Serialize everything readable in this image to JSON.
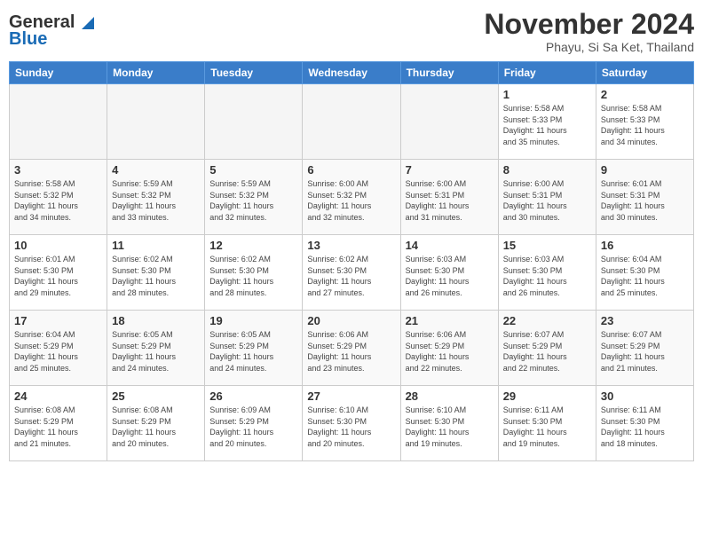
{
  "header": {
    "logo": {
      "line1": "General",
      "line2": "Blue"
    },
    "month": "November 2024",
    "location": "Phayu, Si Sa Ket, Thailand"
  },
  "weekdays": [
    "Sunday",
    "Monday",
    "Tuesday",
    "Wednesday",
    "Thursday",
    "Friday",
    "Saturday"
  ],
  "weeks": [
    {
      "rowClass": "row-odd",
      "days": [
        {
          "num": "",
          "info": "",
          "empty": true
        },
        {
          "num": "",
          "info": "",
          "empty": true
        },
        {
          "num": "",
          "info": "",
          "empty": true
        },
        {
          "num": "",
          "info": "",
          "empty": true
        },
        {
          "num": "",
          "info": "",
          "empty": true
        },
        {
          "num": "1",
          "info": "Sunrise: 5:58 AM\nSunset: 5:33 PM\nDaylight: 11 hours\nand 35 minutes."
        },
        {
          "num": "2",
          "info": "Sunrise: 5:58 AM\nSunset: 5:33 PM\nDaylight: 11 hours\nand 34 minutes."
        }
      ]
    },
    {
      "rowClass": "row-even",
      "days": [
        {
          "num": "3",
          "info": "Sunrise: 5:58 AM\nSunset: 5:32 PM\nDaylight: 11 hours\nand 34 minutes."
        },
        {
          "num": "4",
          "info": "Sunrise: 5:59 AM\nSunset: 5:32 PM\nDaylight: 11 hours\nand 33 minutes."
        },
        {
          "num": "5",
          "info": "Sunrise: 5:59 AM\nSunset: 5:32 PM\nDaylight: 11 hours\nand 32 minutes."
        },
        {
          "num": "6",
          "info": "Sunrise: 6:00 AM\nSunset: 5:32 PM\nDaylight: 11 hours\nand 32 minutes."
        },
        {
          "num": "7",
          "info": "Sunrise: 6:00 AM\nSunset: 5:31 PM\nDaylight: 11 hours\nand 31 minutes."
        },
        {
          "num": "8",
          "info": "Sunrise: 6:00 AM\nSunset: 5:31 PM\nDaylight: 11 hours\nand 30 minutes."
        },
        {
          "num": "9",
          "info": "Sunrise: 6:01 AM\nSunset: 5:31 PM\nDaylight: 11 hours\nand 30 minutes."
        }
      ]
    },
    {
      "rowClass": "row-odd",
      "days": [
        {
          "num": "10",
          "info": "Sunrise: 6:01 AM\nSunset: 5:30 PM\nDaylight: 11 hours\nand 29 minutes."
        },
        {
          "num": "11",
          "info": "Sunrise: 6:02 AM\nSunset: 5:30 PM\nDaylight: 11 hours\nand 28 minutes."
        },
        {
          "num": "12",
          "info": "Sunrise: 6:02 AM\nSunset: 5:30 PM\nDaylight: 11 hours\nand 28 minutes."
        },
        {
          "num": "13",
          "info": "Sunrise: 6:02 AM\nSunset: 5:30 PM\nDaylight: 11 hours\nand 27 minutes."
        },
        {
          "num": "14",
          "info": "Sunrise: 6:03 AM\nSunset: 5:30 PM\nDaylight: 11 hours\nand 26 minutes."
        },
        {
          "num": "15",
          "info": "Sunrise: 6:03 AM\nSunset: 5:30 PM\nDaylight: 11 hours\nand 26 minutes."
        },
        {
          "num": "16",
          "info": "Sunrise: 6:04 AM\nSunset: 5:30 PM\nDaylight: 11 hours\nand 25 minutes."
        }
      ]
    },
    {
      "rowClass": "row-even",
      "days": [
        {
          "num": "17",
          "info": "Sunrise: 6:04 AM\nSunset: 5:29 PM\nDaylight: 11 hours\nand 25 minutes."
        },
        {
          "num": "18",
          "info": "Sunrise: 6:05 AM\nSunset: 5:29 PM\nDaylight: 11 hours\nand 24 minutes."
        },
        {
          "num": "19",
          "info": "Sunrise: 6:05 AM\nSunset: 5:29 PM\nDaylight: 11 hours\nand 24 minutes."
        },
        {
          "num": "20",
          "info": "Sunrise: 6:06 AM\nSunset: 5:29 PM\nDaylight: 11 hours\nand 23 minutes."
        },
        {
          "num": "21",
          "info": "Sunrise: 6:06 AM\nSunset: 5:29 PM\nDaylight: 11 hours\nand 22 minutes."
        },
        {
          "num": "22",
          "info": "Sunrise: 6:07 AM\nSunset: 5:29 PM\nDaylight: 11 hours\nand 22 minutes."
        },
        {
          "num": "23",
          "info": "Sunrise: 6:07 AM\nSunset: 5:29 PM\nDaylight: 11 hours\nand 21 minutes."
        }
      ]
    },
    {
      "rowClass": "row-odd",
      "days": [
        {
          "num": "24",
          "info": "Sunrise: 6:08 AM\nSunset: 5:29 PM\nDaylight: 11 hours\nand 21 minutes."
        },
        {
          "num": "25",
          "info": "Sunrise: 6:08 AM\nSunset: 5:29 PM\nDaylight: 11 hours\nand 20 minutes."
        },
        {
          "num": "26",
          "info": "Sunrise: 6:09 AM\nSunset: 5:29 PM\nDaylight: 11 hours\nand 20 minutes."
        },
        {
          "num": "27",
          "info": "Sunrise: 6:10 AM\nSunset: 5:30 PM\nDaylight: 11 hours\nand 20 minutes."
        },
        {
          "num": "28",
          "info": "Sunrise: 6:10 AM\nSunset: 5:30 PM\nDaylight: 11 hours\nand 19 minutes."
        },
        {
          "num": "29",
          "info": "Sunrise: 6:11 AM\nSunset: 5:30 PM\nDaylight: 11 hours\nand 19 minutes."
        },
        {
          "num": "30",
          "info": "Sunrise: 6:11 AM\nSunset: 5:30 PM\nDaylight: 11 hours\nand 18 minutes."
        }
      ]
    }
  ]
}
